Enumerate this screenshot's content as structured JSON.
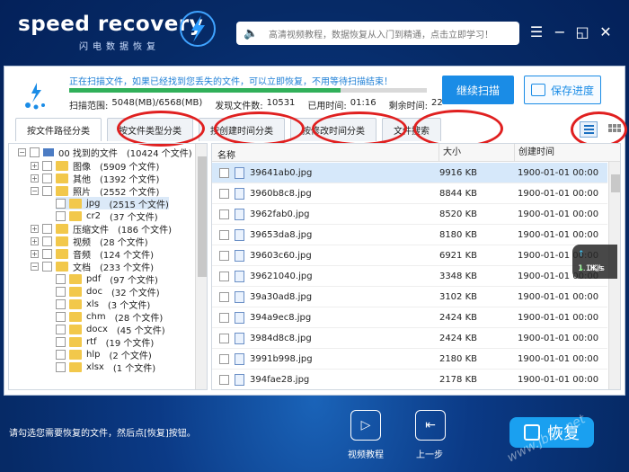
{
  "header": {
    "logo_text": "speed recovery",
    "logo_sub": "闪电数据恢复",
    "search_text": "高清视频教程，数据恢复从入门到精通，点击立即学习！",
    "win_menu": "☰",
    "win_min": "−",
    "win_max": "◱",
    "win_close": "✕"
  },
  "scan": {
    "message": "正在扫描文件，如果已经找到您丢失的文件，可以立即恢复，不用等待扫描结束！",
    "progress": 0.76,
    "range_label": "扫描范围:",
    "range_value": "5048(MB)/6568(MB)",
    "found_label": "发现文件数:",
    "found_value": "10531",
    "elapsed_label": "已用时间:",
    "elapsed_value": "01:16",
    "remaining_label": "剩余时间:",
    "remaining_value": "22",
    "continue_label": "继续扫描",
    "save_label": "保存进度"
  },
  "tabs": [
    {
      "label": "按文件路径分类"
    },
    {
      "label": "按文件类型分类"
    },
    {
      "label": "按创建时间分类"
    },
    {
      "label": "按修改时间分类"
    },
    {
      "label": "文件搜索"
    }
  ],
  "tree": [
    {
      "name": "00 找到的文件",
      "count": "(10424 个文件)"
    },
    {
      "name": "图像",
      "count": "(5909 个文件)"
    },
    {
      "name": "其他",
      "count": "(1392 个文件)"
    },
    {
      "name": "照片",
      "count": "(2552 个文件)"
    },
    {
      "name": "jpg",
      "count": "(2515 个文件)"
    },
    {
      "name": "cr2",
      "count": "(37 个文件)"
    },
    {
      "name": "压缩文件",
      "count": "(186 个文件)"
    },
    {
      "name": "视频",
      "count": "(28 个文件)"
    },
    {
      "name": "音频",
      "count": "(124 个文件)"
    },
    {
      "name": "文档",
      "count": "(233 个文件)"
    },
    {
      "name": "pdf",
      "count": "(97 个文件)"
    },
    {
      "name": "doc",
      "count": "(32 个文件)"
    },
    {
      "name": "xls",
      "count": "(3 个文件)"
    },
    {
      "name": "chm",
      "count": "(28 个文件)"
    },
    {
      "name": "docx",
      "count": "(45 个文件)"
    },
    {
      "name": "rtf",
      "count": "(19 个文件)"
    },
    {
      "name": "hlp",
      "count": "(2 个文件)"
    },
    {
      "name": "xlsx",
      "count": "(1 个文件)"
    }
  ],
  "list": {
    "col_name": "名称",
    "col_size": "大小",
    "col_date": "创建时间",
    "rows": [
      {
        "name": "39641ab0.jpg",
        "size": "9916 KB",
        "date": "1900-01-01  00:00"
      },
      {
        "name": "3960b8c8.jpg",
        "size": "8844 KB",
        "date": "1900-01-01  00:00"
      },
      {
        "name": "3962fab0.jpg",
        "size": "8520 KB",
        "date": "1900-01-01  00:00"
      },
      {
        "name": "39653da8.jpg",
        "size": "8180 KB",
        "date": "1900-01-01  00:00"
      },
      {
        "name": "39603c60.jpg",
        "size": "6921 KB",
        "date": "1900-01-01  00:00"
      },
      {
        "name": "39621040.jpg",
        "size": "3348 KB",
        "date": "1900-01-01  00:00"
      },
      {
        "name": "39a30ad8.jpg",
        "size": "3102 KB",
        "date": "1900-01-01  00:00"
      },
      {
        "name": "394a9ec8.jpg",
        "size": "2424 KB",
        "date": "1900-01-01  00:00"
      },
      {
        "name": "3984d8c8.jpg",
        "size": "2424 KB",
        "date": "1900-01-01  00:00"
      },
      {
        "name": "3991b998.jpg",
        "size": "2180 KB",
        "date": "1900-01-01  00:00"
      },
      {
        "name": "394fae28.jpg",
        "size": "2178 KB",
        "date": "1900-01-01  00:00"
      }
    ]
  },
  "speed": {
    "up": "1.1K/s",
    "down": "0K/s"
  },
  "footer": {
    "hint": "请勾选您需要恢复的文件，然后点[恢复]按钮。",
    "video_label": "视频教程",
    "back_label": "上一步",
    "recover_label": "恢复",
    "watermark": "www.jb51.net"
  },
  "colors": {
    "accent": "#1a8ce6",
    "progress": "#31b05a",
    "annotation": "#e02020"
  }
}
